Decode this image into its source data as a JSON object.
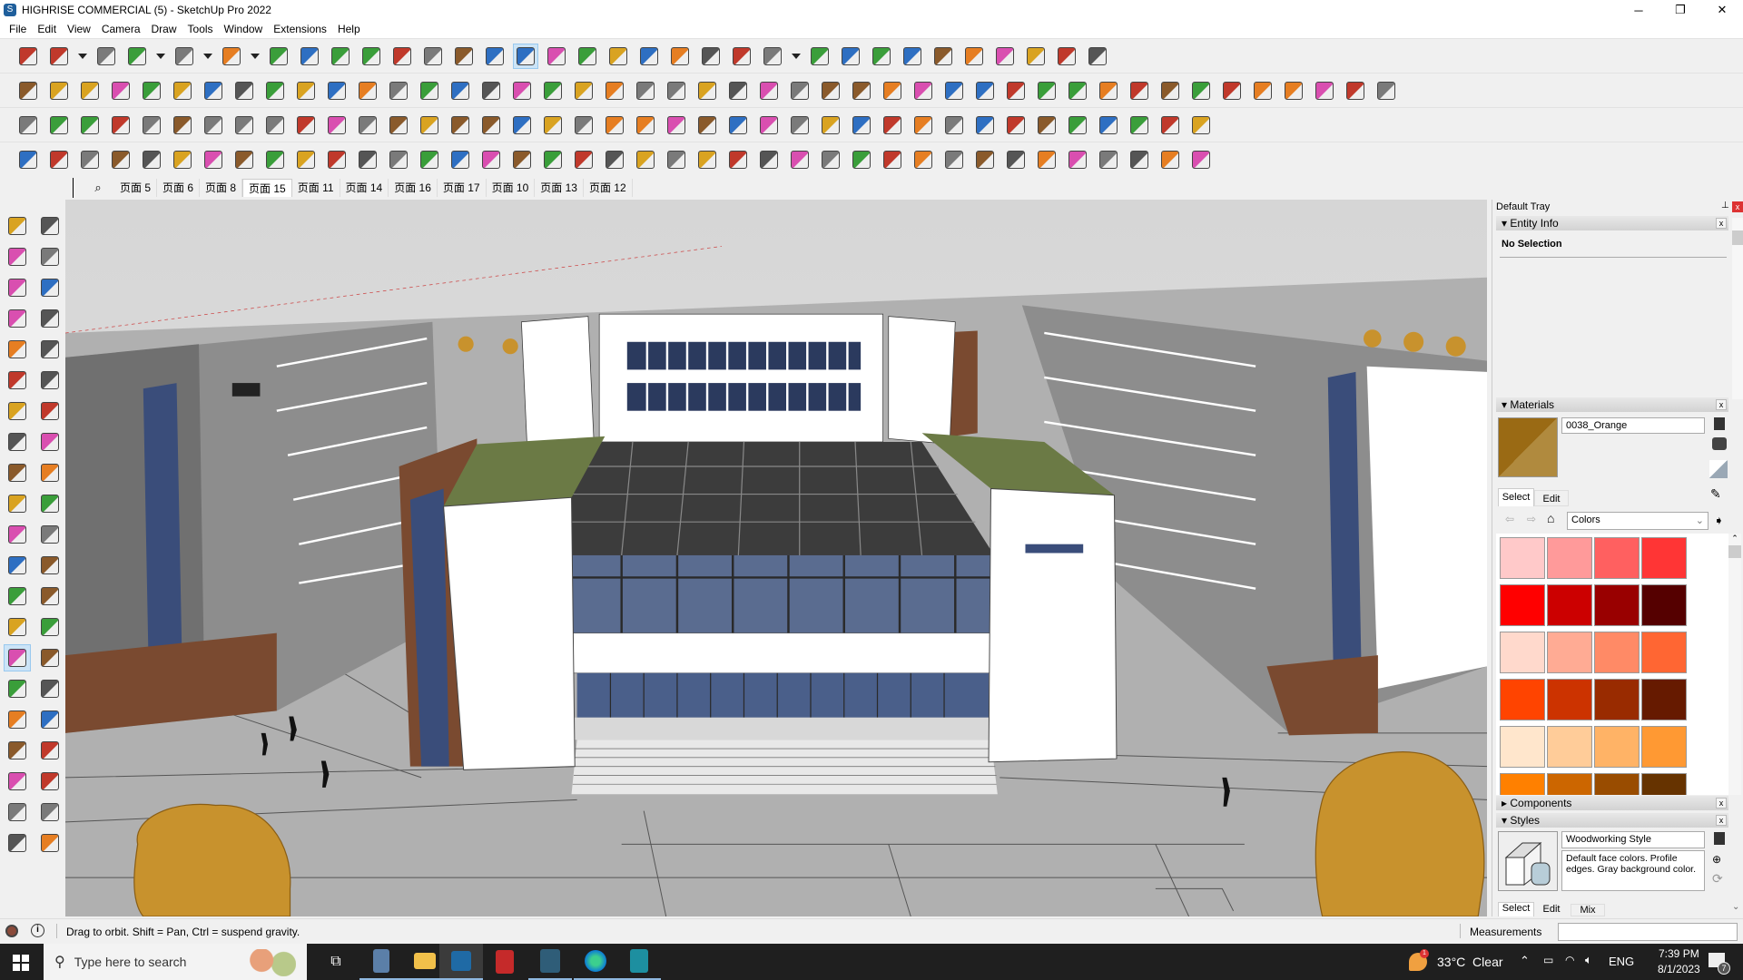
{
  "window": {
    "title": "HIGHRISE COMMERCIAL (5) - SketchUp Pro 2022",
    "minimize": "─",
    "maximize": "❐",
    "close": "✕"
  },
  "menu": [
    "File",
    "Edit",
    "View",
    "Camera",
    "Draw",
    "Tools",
    "Window",
    "Extensions",
    "Help"
  ],
  "toolbars": {
    "row1": [
      "zoom-icon",
      "select-icon",
      "dropdown-icon",
      "eraser-icon",
      "pencil-icon",
      "dropdown-icon",
      "arc-icon",
      "dropdown-icon",
      "rectangle-icon",
      "dropdown-icon",
      "push-pull-icon",
      "follow-me-icon",
      "move-icon",
      "rotate-icon",
      "scale-icon",
      "tape-measure-icon",
      "text-icon",
      "paint-bucket-icon",
      "orbit-icon",
      "pan-icon",
      "zoom-window-icon",
      "zoom-extents-icon",
      "section-plane-icon",
      "section-fill-icon",
      "layers-icon",
      "warehouse-icon",
      "account-icon",
      "dropdown-icon",
      "extension-icon",
      "component-icon",
      "axes-icon",
      "sort-icon",
      "sort-down-icon",
      "align-icon",
      "mirror-icon",
      "undo-icon",
      "redo-icon",
      "clear-icon"
    ],
    "row2": [
      "iso-view-icon",
      "top-view-icon",
      "front-view-icon",
      "sandbox-icon",
      "smoove-icon",
      "section-icon",
      "section2-icon",
      "section3-icon",
      "curve-icon",
      "joint-push-pull-icon",
      "push-eq-icon",
      "push-j-icon",
      "push-r-icon",
      "push-v-icon",
      "push-n-icon",
      "push-x-icon",
      "push-f-icon",
      "house-icon",
      "window-icon",
      "home-icon",
      "roof-icon",
      "house2-icon",
      "roof2-icon",
      "wall-icon",
      "grid-icon",
      "block-icon",
      "block2-icon",
      "cylinder-icon",
      "slab-icon",
      "stair-icon",
      "fx-icon",
      "leaf-icon",
      "knife-icon",
      "shape-rect-icon",
      "shape-circle-icon",
      "shape-hex-icon",
      "shape-ellipse-icon",
      "shape-para-icon",
      "shape-curve-icon",
      "shape-ring-icon",
      "shape-knot-icon",
      "tag-icon",
      "loop-icon",
      "line-tool-icon",
      "eraser2-icon"
    ],
    "row3": [
      "face-hash-icon",
      "face-blue-icon",
      "face-yellow-icon",
      "face-green-icon",
      "face-red-icon",
      "face-grid-icon",
      "round-corner-icon",
      "frame-icon",
      "divider-icon",
      "flag-icon",
      "box-icon",
      "pipe-icon",
      "angle-icon",
      "chain-icon",
      "cross-red-icon",
      "cross-green-icon",
      "cross-blue-icon",
      "drop-icon",
      "drop-hash-icon",
      "cone-icon",
      "spiral-icon",
      "spiral2-icon",
      "spiral3-icon",
      "arrows-icon",
      "cube-icon",
      "loop2-icon",
      "tree-icon",
      "stack-icon",
      "stack2-icon",
      "stack3-icon",
      "stack4-icon",
      "mesh-icon",
      "panel-icon",
      "grid-orange-icon",
      "grid-orange2-icon",
      "grid-orange3-icon",
      "scatter-icon",
      "curve2-icon",
      "grid-small-icon"
    ],
    "row4": [
      "point-icon",
      "bezier-icon",
      "weld-icon",
      "split-icon",
      "circle-dots-icon",
      "extrude-icon",
      "bend-icon",
      "loft-icon",
      "shell-icon",
      "vertex-icon",
      "corner-icon",
      "corner2-icon",
      "angle2-icon",
      "fillet-icon",
      "frame2-icon",
      "wing-icon",
      "bars-icon",
      "bars2-icon",
      "hand-icon",
      "sheet-icon",
      "arrow-left-icon",
      "stairs-icon",
      "blade-icon",
      "hatch-icon",
      "hatch2-icon",
      "hatch3-icon",
      "terrain-icon",
      "stairs2-icon",
      "panel2-icon",
      "panel3-icon",
      "column-icon",
      "lattice-icon",
      "fins-icon",
      "fins2-icon",
      "sphere-icon",
      "sphere2-icon",
      "fan-icon",
      "fan2-icon",
      "cloud-icon"
    ]
  },
  "scenes": {
    "search": "⌕",
    "tabs": [
      "页面 5",
      "页面 6",
      "页面 8",
      "页面 15",
      "页面 11",
      "页面 14",
      "页面 16",
      "页面 17",
      "页面 10",
      "页面 13",
      "页面 12"
    ],
    "selected": 3
  },
  "left_tools": [
    "select-icon",
    "orbit-icon",
    "paint-icon",
    "eraser-icon",
    "component-icon",
    "pencil-icon",
    "line-icon",
    "freehand-icon",
    "rectangle-icon",
    "rotated-rect-icon",
    "circle-icon",
    "polygon-icon",
    "arc-icon",
    "pie-icon",
    "arc3-icon",
    "arc2-icon",
    "move-icon",
    "push-pull-icon",
    "rotate-icon",
    "follow-me-icon",
    "scale-icon",
    "offset-icon",
    "tape-icon",
    "dimension-icon",
    "protractor-icon",
    "text-icon",
    "axes-icon",
    "3d-text-icon",
    "orbit-active-icon",
    "pan-icon",
    "zoom-icon",
    "zoom-window-icon",
    "zoom-extents-icon",
    "previous-icon",
    "walk-icon",
    "look-around-icon",
    "footprints-icon",
    "position-camera-icon",
    "section-plane-icon",
    "section-display-icon",
    "section-cut-icon",
    "section-fill-icon"
  ],
  "tray": {
    "title": "Default Tray",
    "pin": "⊥",
    "close": "x",
    "entity_info": {
      "header": "Entity Info",
      "status": "No Selection"
    },
    "materials": {
      "header": "Materials",
      "name": "0038_Orange",
      "swatch_color": "#9a6a14",
      "tabs": [
        "Select",
        "Edit"
      ],
      "library": "Colors",
      "colors": [
        "#ffc9c9",
        "#ff9a9a",
        "#ff6060",
        "#ff3535",
        "#ff0000",
        "#cc0000",
        "#990000",
        "#550000",
        "#ffd9cc",
        "#ffab94",
        "#ff8a66",
        "#ff6633",
        "#ff4400",
        "#cc3300",
        "#992b00",
        "#661a00",
        "#ffe6cc",
        "#ffcc99",
        "#ffb366",
        "#ff9933",
        "#ff8000",
        "#cc6600",
        "#994c00",
        "#663300"
      ]
    },
    "components": {
      "header": "Components"
    },
    "styles": {
      "header": "Styles",
      "name": "Woodworking Style",
      "description": "Default face colors. Profile edges. Gray background color.",
      "tabs": [
        "Select",
        "Edit",
        "Mix"
      ]
    }
  },
  "status": {
    "message": "Drag to orbit. Shift = Pan, Ctrl = suspend gravity.",
    "measurements_label": "Measurements",
    "measurements_value": ""
  },
  "taskbar": {
    "search_placeholder": "Type here to search",
    "weather": "33°C  Clear",
    "weather_badge": "1",
    "language": "ENG",
    "time": "7:39 PM",
    "date": "8/1/2023",
    "notifications": "7"
  }
}
